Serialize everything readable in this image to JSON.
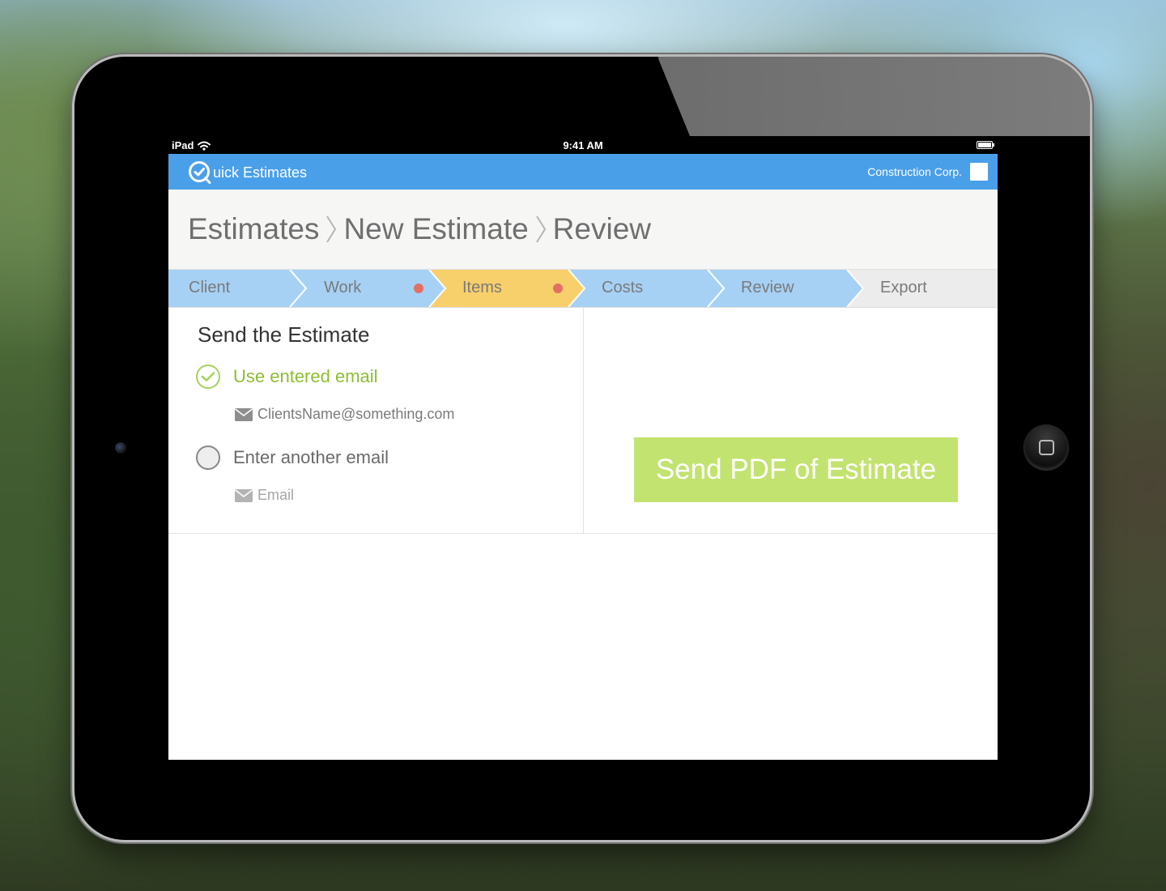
{
  "status_bar": {
    "device": "iPad",
    "time": "9:41 AM"
  },
  "app": {
    "title": "uick Estimates",
    "company": "Construction Corp."
  },
  "breadcrumb": [
    "Estimates",
    "New Estimate",
    "Review"
  ],
  "steps": [
    {
      "label": "Client"
    },
    {
      "label": "Work"
    },
    {
      "label": "Items"
    },
    {
      "label": "Costs"
    },
    {
      "label": "Review"
    },
    {
      "label": "Export"
    }
  ],
  "send_section": {
    "title": "Send the Estimate",
    "option_entered": "Use entered email",
    "entered_email": "ClientsName@something.com",
    "option_other": "Enter another email",
    "other_placeholder": "Email"
  },
  "send_button": "Send PDF of Estimate",
  "colors": {
    "accent_blue": "#4a9fe9",
    "step_done": "#a6d1f5",
    "step_current": "#f7cf6b",
    "step_pending": "#ececec",
    "alert_dot": "#e46e64",
    "success_green": "#a5d35c",
    "button_green": "#c2e36f"
  },
  "icons": [
    "wifi-icon",
    "battery-icon",
    "logo-check-icon",
    "chevron-right-icon",
    "check-icon",
    "mail-icon",
    "home-button-icon"
  ]
}
